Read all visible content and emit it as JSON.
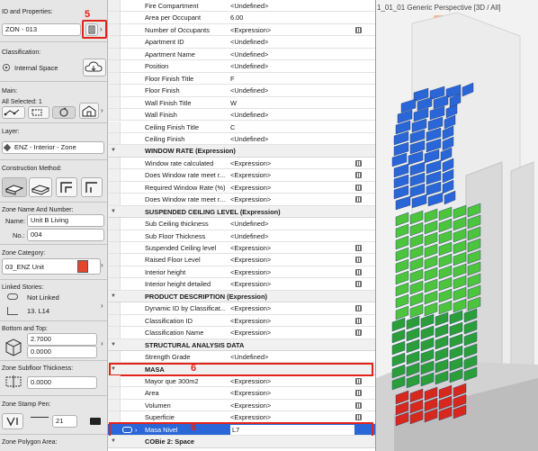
{
  "left_panel": {
    "id_section_label": "ID and Properties:",
    "zone_id": "ZON - 013",
    "classification_label": "Classification:",
    "classification_value": "Internal Space",
    "main_label": "Main:",
    "all_selected": "All Selected: 1",
    "layer_label": "Layer:",
    "layer_value": "ENZ - Interior - Zone",
    "construction_label": "Construction Method:",
    "zone_name_label": "Zone Name And Number:",
    "name_label": "Name:",
    "name_value": "Unit B  Living",
    "no_label": "No.:",
    "no_value": "004",
    "category_label": "Zone Category:",
    "category_value": "03_ENZ Unit",
    "category_color": "#e8452f",
    "linked_label": "Linked Stories:",
    "linked_value": "Not Linked",
    "story_value": "13. L14",
    "bottom_top_label": "Bottom and Top:",
    "top_value": "2.7000",
    "bottom_value": "0.0000",
    "subfloor_label": "Zone Subfloor Thickness:",
    "subfloor_value": "0.0000",
    "stamp_label": "Zone Stamp Pen:",
    "stamp_value": "21",
    "polygon_label": "Zone Polygon Area:",
    "badge": "5"
  },
  "table": {
    "items": [
      {
        "kind": "row",
        "name": "Fire Compartment",
        "value": "<Undefined>"
      },
      {
        "kind": "row",
        "name": "Area per Occupant",
        "value": "6.00"
      },
      {
        "kind": "row",
        "name": "Number of Occupants",
        "value": "<Expression>",
        "calc": true
      },
      {
        "kind": "row",
        "name": "Apartment ID",
        "value": "<Undefined>"
      },
      {
        "kind": "row",
        "name": "Apartment Name",
        "value": "<Undefined>"
      },
      {
        "kind": "row",
        "name": "Position",
        "value": "<Undefined>"
      },
      {
        "kind": "row",
        "name": "Floor Finish Title",
        "value": "F"
      },
      {
        "kind": "row",
        "name": "Floor Finish",
        "value": "<Undefined>"
      },
      {
        "kind": "row",
        "name": "Wall Finish Title",
        "value": "W"
      },
      {
        "kind": "row",
        "name": "Wall Finish",
        "value": "<Undefined>"
      },
      {
        "kind": "row",
        "name": "Ceiling Finish Title",
        "value": "C"
      },
      {
        "kind": "row",
        "name": "Ceiling Finish",
        "value": "<Undefined>"
      },
      {
        "kind": "group",
        "name": "WINDOW RATE (Expression)"
      },
      {
        "kind": "row",
        "name": "Window rate calculated",
        "value": "<Expression>",
        "calc": true
      },
      {
        "kind": "row",
        "name": "Does Window rate meet r...",
        "value": "<Expression>",
        "calc": true
      },
      {
        "kind": "row",
        "name": "Required Window Rate (%)",
        "value": "<Expression>",
        "calc": true
      },
      {
        "kind": "row",
        "name": "Does Window rate meet r...",
        "value": "<Expression>",
        "calc": true
      },
      {
        "kind": "group",
        "name": "SUSPENDED CEILING LEVEL (Expression)"
      },
      {
        "kind": "row",
        "name": "Sub Ceiling thickness",
        "value": "<Undefined>"
      },
      {
        "kind": "row",
        "name": "Sub Floor Thickness",
        "value": "<Undefined>"
      },
      {
        "kind": "row",
        "name": "Suspended Ceiling level",
        "value": "<Expression>",
        "calc": true
      },
      {
        "kind": "row",
        "name": "Raised Floor Level",
        "value": "<Expression>",
        "calc": true
      },
      {
        "kind": "row",
        "name": "Interior height",
        "value": "<Expression>",
        "calc": true
      },
      {
        "kind": "row",
        "name": "Interior height detailed",
        "value": "<Expression>",
        "calc": true
      },
      {
        "kind": "group",
        "name": "PRODUCT DESCRIPTION (Expression)"
      },
      {
        "kind": "row",
        "name": "Dynamic ID by Classificat...",
        "value": "<Expression>",
        "calc": true
      },
      {
        "kind": "row",
        "name": "Classification ID",
        "value": "<Expression>",
        "calc": true
      },
      {
        "kind": "row",
        "name": "Classification Name",
        "value": "<Expression>",
        "calc": true
      },
      {
        "kind": "group",
        "name": "STRUCTURAL ANALYSIS DATA"
      },
      {
        "kind": "row",
        "name": "Strength Grade",
        "value": "<Undefined>"
      },
      {
        "kind": "group",
        "name": "MASA",
        "badge": "6",
        "highlight": true
      },
      {
        "kind": "row",
        "name": "Mayor que 300m2",
        "value": "<Expression>",
        "calc": true
      },
      {
        "kind": "row",
        "name": "Area",
        "value": "<Expression>",
        "calc": true
      },
      {
        "kind": "row",
        "name": "Volumen",
        "value": "<Expression>",
        "calc": true
      },
      {
        "kind": "row",
        "name": "Superficie",
        "value": "<Expression>",
        "calc": true
      },
      {
        "kind": "selected",
        "name": "Masa Nivel",
        "value": "L7",
        "badge": "6"
      },
      {
        "kind": "group",
        "name": "COBie 2: Space"
      }
    ]
  },
  "view": {
    "title": "1_01_01 Generic Perspective [3D / All]",
    "highlight_color": "#2a66d8",
    "mass_colors": {
      "blue": "#2a66d8",
      "green": "#4cc43b",
      "dark_green": "#2b9e3a",
      "red": "#d8281e"
    }
  }
}
